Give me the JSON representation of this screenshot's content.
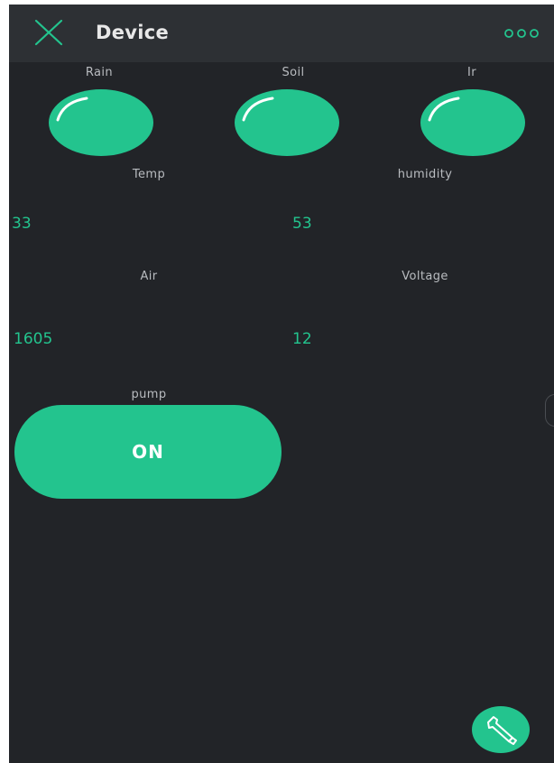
{
  "header": {
    "title": "Device",
    "close_icon": "close-icon",
    "more_icon": "more-icon"
  },
  "widgets": {
    "rain_label": "Rain",
    "soil_label": "Soil",
    "ir_label": "Ir",
    "temp_label": "Temp",
    "temp_value": "33",
    "humidity_label": "humidity",
    "humidity_value": "53",
    "air_label": "Air",
    "air_value": "1605",
    "voltage_label": "Voltage",
    "voltage_value": "12",
    "pump_label": "pump",
    "pump_button": "ON"
  },
  "fab": {
    "icon": "wrench-icon"
  },
  "colors": {
    "accent": "#23c48e",
    "background": "#222428",
    "header": "#2d3034"
  }
}
